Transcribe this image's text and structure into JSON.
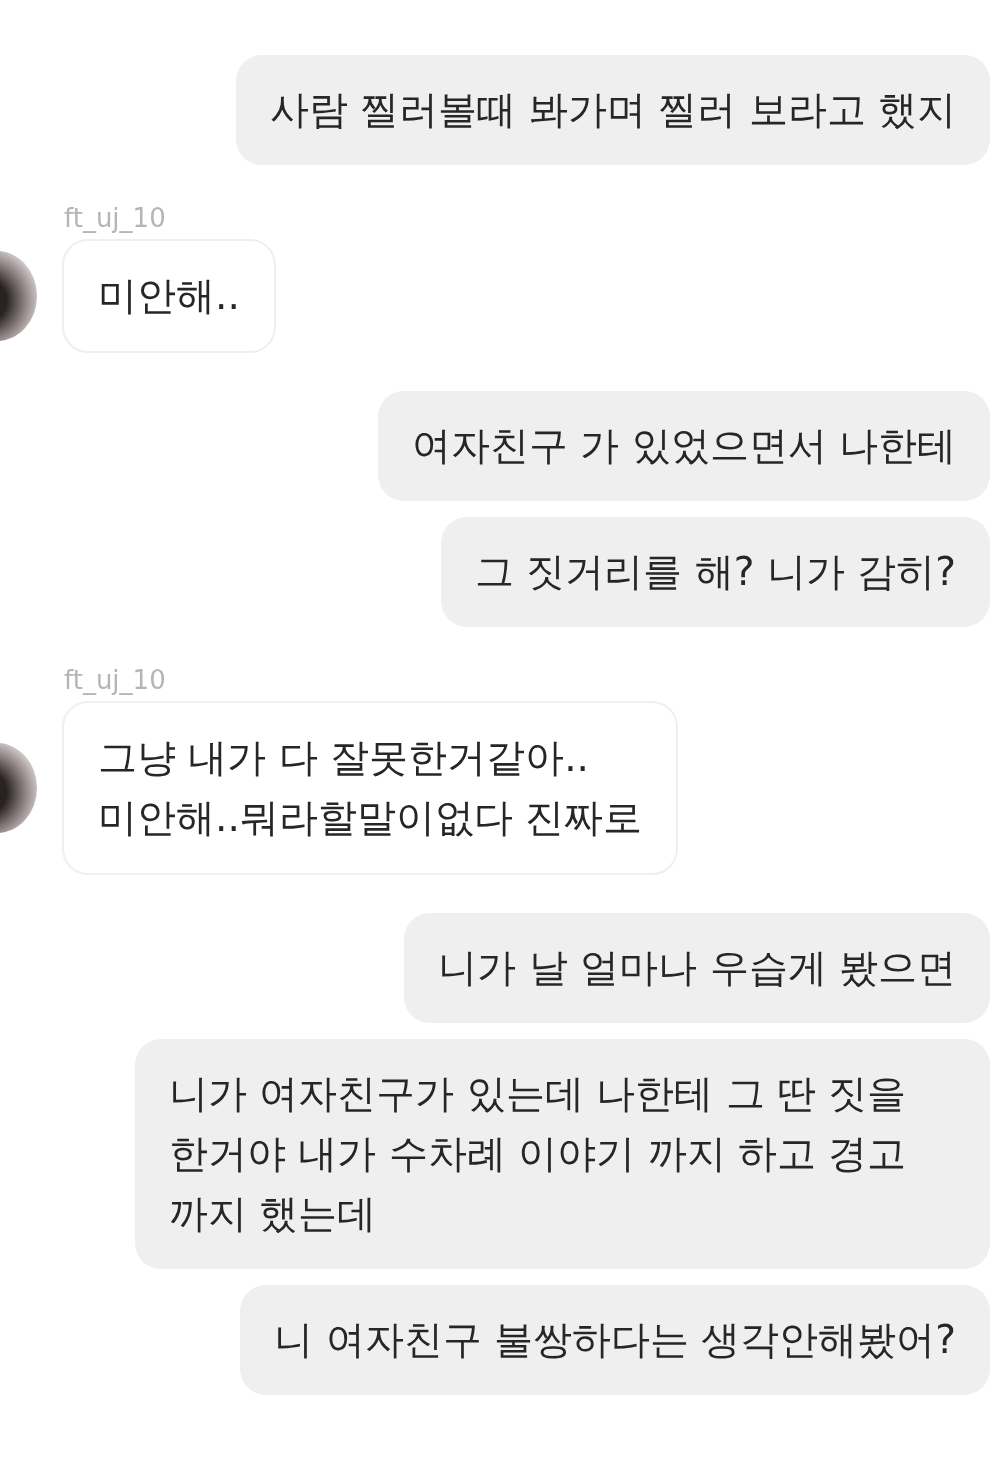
{
  "groups": [
    {
      "kind": "sent",
      "messages": [
        "사람 찔러볼때 봐가며 찔러 보라고 했지"
      ]
    },
    {
      "kind": "received",
      "username": "ft_uj_10",
      "messages": [
        "미안해.."
      ]
    },
    {
      "kind": "sent",
      "messages": [
        "여자친구 가 있었으면서 나한테",
        "그 짓거리를 해? 니가 감히?"
      ]
    },
    {
      "kind": "received",
      "username": "ft_uj_10",
      "messages": [
        "그냥 내가 다 잘못한거같아..\n미안해..뭐라할말이없다 진짜로"
      ]
    },
    {
      "kind": "sent",
      "messages": [
        "니가 날 얼마나 우습게 봤으면",
        "니가 여자친구가 있는데 나한테 그 딴 짓을 한거야 내가 수차례 이야기 까지 하고 경고 까지 했는데",
        "니 여자친구 불쌍하다는 생각안해봤어?"
      ]
    }
  ]
}
